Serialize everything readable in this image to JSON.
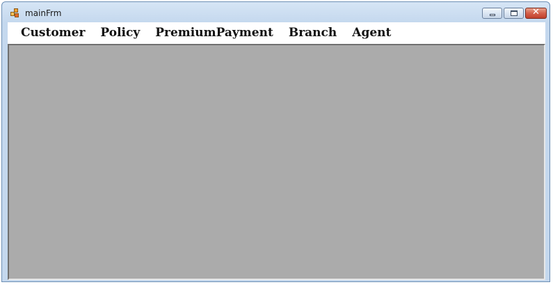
{
  "window": {
    "title": "mainFrm",
    "icons": {
      "app": "app-form-icon",
      "minimize": "minimize-icon",
      "maximize": "maximize-icon",
      "close": "close-icon"
    },
    "close_glyph": "✕"
  },
  "menu": {
    "items": [
      {
        "label": "Customer"
      },
      {
        "label": "Policy"
      },
      {
        "label": "PremiumPayment"
      },
      {
        "label": "Branch"
      },
      {
        "label": "Agent"
      }
    ]
  },
  "colors": {
    "mdi_background": "#ababab",
    "titlebar": "#c4d8ee",
    "close_button": "#c0402c"
  }
}
